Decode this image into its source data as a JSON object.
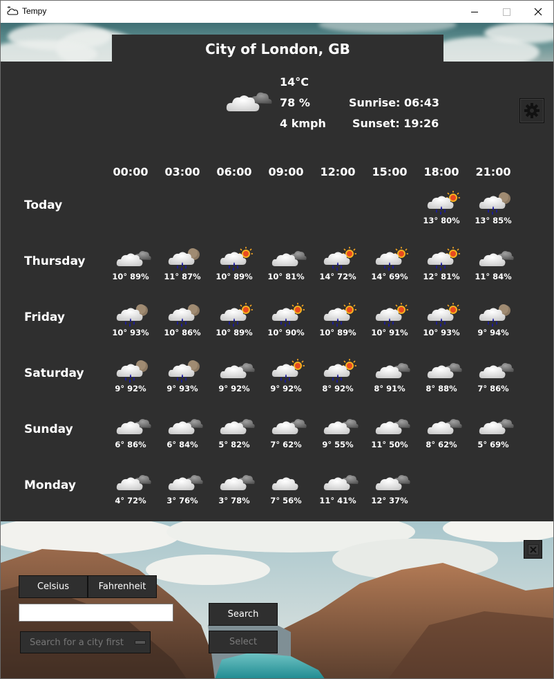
{
  "window": {
    "title": "Tempy"
  },
  "current": {
    "city": "City of London, GB",
    "temperature": "14°C",
    "humidity": "78 %",
    "wind": "4 kmph",
    "sunrise": "Sunrise: 06:43",
    "sunset": "Sunset: 19:26",
    "icon": "cloudy"
  },
  "hours": [
    "00:00",
    "03:00",
    "06:00",
    "09:00",
    "12:00",
    "15:00",
    "18:00",
    "21:00"
  ],
  "days": [
    {
      "name": "Today",
      "cells": [
        null,
        null,
        null,
        null,
        null,
        null,
        {
          "icon": "rain-day",
          "text": "13° 80%"
        },
        {
          "icon": "rain-night",
          "text": "13° 85%"
        }
      ]
    },
    {
      "name": "Thursday",
      "cells": [
        {
          "icon": "cloudy",
          "text": "10° 89%"
        },
        {
          "icon": "rain-night",
          "text": "11° 87%"
        },
        {
          "icon": "rain-day",
          "text": "10° 89%"
        },
        {
          "icon": "cloudy",
          "text": "10° 81%"
        },
        {
          "icon": "rain-day",
          "text": "14° 72%"
        },
        {
          "icon": "rain-day",
          "text": "14° 69%"
        },
        {
          "icon": "rain-day",
          "text": "12° 81%"
        },
        {
          "icon": "cloudy",
          "text": "11° 84%"
        }
      ]
    },
    {
      "name": "Friday",
      "cells": [
        {
          "icon": "rain-night",
          "text": "10° 93%"
        },
        {
          "icon": "rain-night",
          "text": "10° 86%"
        },
        {
          "icon": "rain-day",
          "text": "10° 89%"
        },
        {
          "icon": "rain-day",
          "text": "10° 90%"
        },
        {
          "icon": "rain-day",
          "text": "10° 89%"
        },
        {
          "icon": "rain-day",
          "text": "10° 91%"
        },
        {
          "icon": "rain-day",
          "text": "10° 93%"
        },
        {
          "icon": "rain-night",
          "text": "9° 94%"
        }
      ]
    },
    {
      "name": "Saturday",
      "cells": [
        {
          "icon": "rain-night",
          "text": "9° 92%"
        },
        {
          "icon": "rain-night",
          "text": "9° 93%"
        },
        {
          "icon": "cloudy",
          "text": "9° 92%"
        },
        {
          "icon": "rain-day",
          "text": "9° 92%"
        },
        {
          "icon": "rain-day",
          "text": "8° 92%"
        },
        {
          "icon": "cloudy",
          "text": "8° 91%"
        },
        {
          "icon": "cloudy",
          "text": "8° 88%"
        },
        {
          "icon": "cloudy",
          "text": "7° 86%"
        }
      ]
    },
    {
      "name": "Sunday",
      "cells": [
        {
          "icon": "cloudy",
          "text": "6° 86%"
        },
        {
          "icon": "cloudy",
          "text": "6° 84%"
        },
        {
          "icon": "cloudy",
          "text": "5° 82%"
        },
        {
          "icon": "cloudy",
          "text": "7° 62%"
        },
        {
          "icon": "cloudy",
          "text": "9° 55%"
        },
        {
          "icon": "cloudy",
          "text": "11° 50%"
        },
        {
          "icon": "cloudy",
          "text": "8° 62%"
        },
        {
          "icon": "cloudy",
          "text": "5° 69%"
        }
      ]
    },
    {
      "name": "Monday",
      "cells": [
        {
          "icon": "cloudy",
          "text": "4° 72%"
        },
        {
          "icon": "cloudy",
          "text": "3° 76%"
        },
        {
          "icon": "cloudy",
          "text": "3° 78%"
        },
        {
          "icon": "cloud",
          "text": "7° 56%"
        },
        {
          "icon": "cloudy",
          "text": "11° 41%"
        },
        {
          "icon": "cloudy",
          "text": "12° 37%"
        },
        null,
        null
      ]
    }
  ],
  "controls": {
    "celsius": "Celsius",
    "fahrenheit": "Fahrenheit",
    "search_value": "",
    "search_button": "Search",
    "select_placeholder": "Search for a city first",
    "select_button": "Select"
  },
  "colors": {
    "panel": "#2f2f2f",
    "text": "#ffffff",
    "rain": "#1a1aa0",
    "sun": "#f5a623"
  }
}
